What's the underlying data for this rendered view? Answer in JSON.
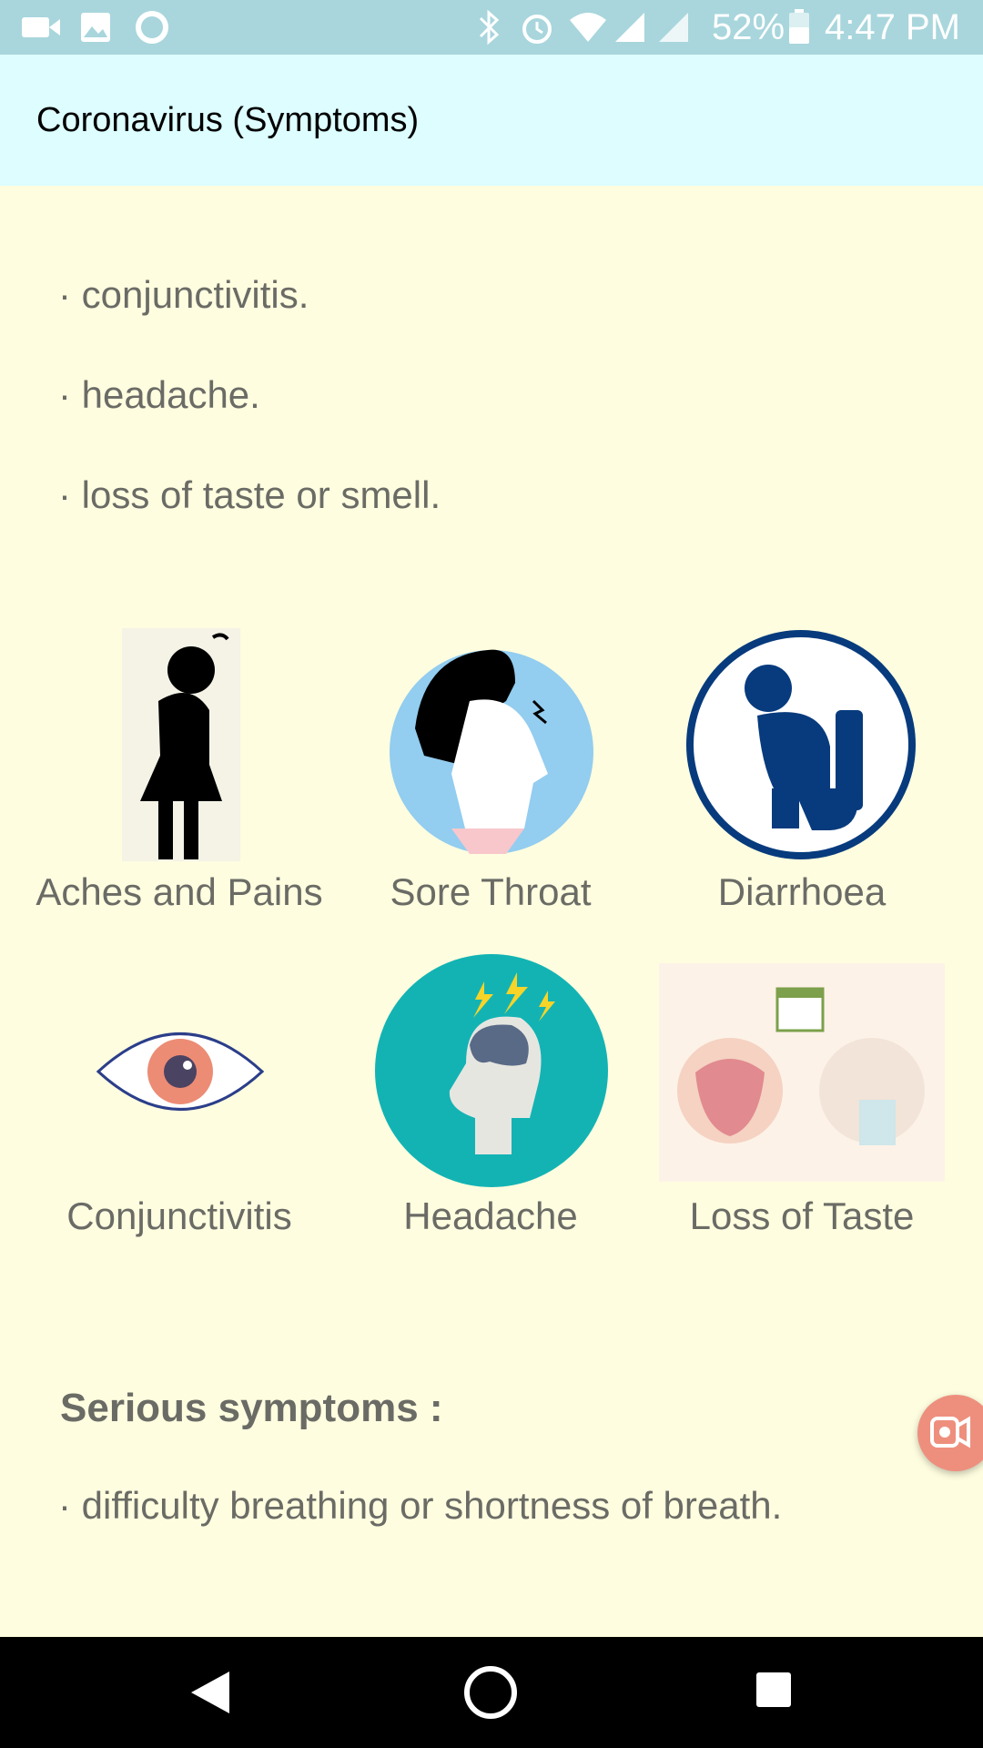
{
  "status_bar": {
    "battery": "52%",
    "time": "4:47 PM"
  },
  "app_bar": {
    "title": "Coronavirus (Symptoms)"
  },
  "symptoms_list": [
    "· conjunctivitis.",
    "· headache.",
    "· loss of taste or smell."
  ],
  "symptom_grid": [
    {
      "label": "Aches and Pains",
      "icon": "aches-pains-icon"
    },
    {
      "label": "Sore Throat",
      "icon": "sore-throat-icon"
    },
    {
      "label": "Diarrhoea",
      "icon": "diarrhoea-icon"
    },
    {
      "label": "Conjunctivitis",
      "icon": "conjunctivitis-icon"
    },
    {
      "label": "Headache",
      "icon": "headache-icon"
    },
    {
      "label": "Loss of Taste",
      "icon": "loss-of-taste-icon"
    }
  ],
  "serious": {
    "title": "Serious symptoms :",
    "items": [
      "· difficulty breathing or shortness of breath."
    ]
  },
  "colors": {
    "status_bar": "#a8d6dc",
    "app_bar": "#ddfdff",
    "background": "#fefddf",
    "text": "#6b6b66",
    "fab": "#ee8f7d"
  }
}
